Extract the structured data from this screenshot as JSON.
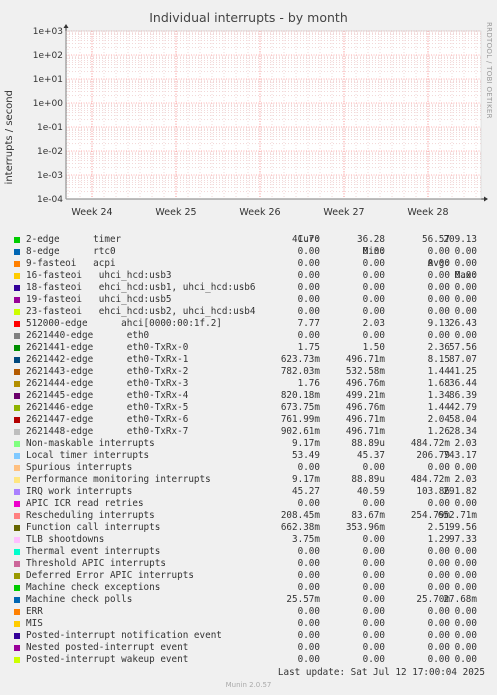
{
  "title": "Individual interrupts - by month",
  "side_note": "RRDTOOL / TOBI OETIKER",
  "footer": "Last update: Sat Jul 12 17:00:04 2025",
  "munin": "Munin 2.0.57",
  "colors": {
    "background": "#f0f0f0",
    "plot": "#ffffff",
    "grid_minor": "#e6b0b0",
    "grid_major": "#ff6666"
  },
  "legend_header": {
    "cur": "Cur:",
    "min": "Min:",
    "avg": "Avg:",
    "max": "Max:"
  },
  "chart_data": {
    "type": "line",
    "title": "Individual interrupts - by month",
    "ylabel": "interrupts / second",
    "yscale": "log",
    "ylim": [
      0.0001,
      1000
    ],
    "y_ticks": [
      "1e+03",
      "1e+02",
      "1e+01",
      "1e+00",
      "1e-01",
      "1e-02",
      "1e-03",
      "1e-04"
    ],
    "x_ticks": [
      "Week 24",
      "Week 25",
      "Week 26",
      "Week 27",
      "Week 28"
    ],
    "grid": true,
    "legend_position": "bottom",
    "series": [
      {
        "name": "2-edge      timer",
        "color": "#00cc00",
        "cur": "41.70",
        "min": "36.28",
        "avg": "56.57",
        "max": "209.13"
      },
      {
        "name": "8-edge      rtc0",
        "color": "#0066b3",
        "cur": "0.00",
        "min": "0.00",
        "avg": "0.00",
        "max": "0.00"
      },
      {
        "name": "9-fasteoi   acpi",
        "color": "#ff8000",
        "cur": "0.00",
        "min": "0.00",
        "avg": "0.00",
        "max": "0.00"
      },
      {
        "name": "16-fasteoi   uhci_hcd:usb3",
        "color": "#ffcc00",
        "cur": "0.00",
        "min": "0.00",
        "avg": "0.00",
        "max": "0.00"
      },
      {
        "name": "18-fasteoi   ehci_hcd:usb1, uhci_hcd:usb6",
        "color": "#330099",
        "cur": "0.00",
        "min": "0.00",
        "avg": "0.00",
        "max": "0.00"
      },
      {
        "name": "19-fasteoi   uhci_hcd:usb5",
        "color": "#990099",
        "cur": "0.00",
        "min": "0.00",
        "avg": "0.00",
        "max": "0.00"
      },
      {
        "name": "23-fasteoi   ehci_hcd:usb2, uhci_hcd:usb4",
        "color": "#ccff00",
        "cur": "0.00",
        "min": "0.00",
        "avg": "0.00",
        "max": "0.00"
      },
      {
        "name": "512000-edge      ahci[0000:00:1f.2]",
        "color": "#ff0000",
        "cur": "7.77",
        "min": "2.03",
        "avg": "9.13",
        "max": "26.43"
      },
      {
        "name": "2621440-edge      eth0",
        "color": "#808080",
        "cur": "0.00",
        "min": "0.00",
        "avg": "0.00",
        "max": "0.00"
      },
      {
        "name": "2621441-edge      eth0-TxRx-0",
        "color": "#008f00",
        "cur": "1.75",
        "min": "1.50",
        "avg": "2.36",
        "max": "57.56"
      },
      {
        "name": "2621442-edge      eth0-TxRx-1",
        "color": "#00487d",
        "cur": "623.73m",
        "min": "496.71m",
        "avg": "8.15",
        "max": "87.07"
      },
      {
        "name": "2621443-edge      eth0-TxRx-2",
        "color": "#b35a00",
        "cur": "782.03m",
        "min": "532.58m",
        "avg": "1.44",
        "max": "41.25"
      },
      {
        "name": "2621444-edge      eth0-TxRx-3",
        "color": "#b38f00",
        "cur": "1.76",
        "min": "496.76m",
        "avg": "1.68",
        "max": "36.44"
      },
      {
        "name": "2621445-edge      eth0-TxRx-4",
        "color": "#6b006b",
        "cur": "820.18m",
        "min": "499.21m",
        "avg": "1.34",
        "max": "86.39"
      },
      {
        "name": "2621446-edge      eth0-TxRx-5",
        "color": "#8fb300",
        "cur": "673.75m",
        "min": "496.76m",
        "avg": "1.44",
        "max": "42.79"
      },
      {
        "name": "2621447-edge      eth0-TxRx-6",
        "color": "#b30000",
        "cur": "761.99m",
        "min": "496.71m",
        "avg": "2.04",
        "max": "58.04"
      },
      {
        "name": "2621448-edge      eth0-TxRx-7",
        "color": "#bebebe",
        "cur": "902.61m",
        "min": "496.71m",
        "avg": "1.26",
        "max": "28.34"
      },
      {
        "name": "Non-maskable interrupts",
        "color": "#80ff80",
        "cur": "9.17m",
        "min": "88.89u",
        "avg": "484.72m",
        "max": "2.03"
      },
      {
        "name": "Local timer interrupts",
        "color": "#80c9ff",
        "cur": "53.49",
        "min": "45.37",
        "avg": "206.79",
        "max": "743.17"
      },
      {
        "name": "Spurious interrupts",
        "color": "#ffc080",
        "cur": "0.00",
        "min": "0.00",
        "avg": "0.00",
        "max": "0.00"
      },
      {
        "name": "Performance monitoring interrupts",
        "color": "#ffe680",
        "cur": "9.17m",
        "min": "88.89u",
        "avg": "484.72m",
        "max": "2.03"
      },
      {
        "name": "IRQ work interrupts",
        "color": "#aa80ff",
        "cur": "45.27",
        "min": "40.59",
        "avg": "103.86",
        "max": "291.82"
      },
      {
        "name": "APIC ICR read retries",
        "color": "#ee00cc",
        "cur": "0.00",
        "min": "0.00",
        "avg": "0.00",
        "max": "0.00"
      },
      {
        "name": "Rescheduling interrupts",
        "color": "#ff8080",
        "cur": "208.45m",
        "min": "83.67m",
        "avg": "254.79m",
        "max": "652.71m"
      },
      {
        "name": "Function call interrupts",
        "color": "#666600",
        "cur": "662.38m",
        "min": "353.96m",
        "avg": "2.51",
        "max": "99.56"
      },
      {
        "name": "TLB shootdowns",
        "color": "#ffbfff",
        "cur": "3.75m",
        "min": "0.00",
        "avg": "1.29",
        "max": "97.33"
      },
      {
        "name": "Thermal event interrupts",
        "color": "#00ffcc",
        "cur": "0.00",
        "min": "0.00",
        "avg": "0.00",
        "max": "0.00"
      },
      {
        "name": "Threshold APIC interrupts",
        "color": "#cc6699",
        "cur": "0.00",
        "min": "0.00",
        "avg": "0.00",
        "max": "0.00"
      },
      {
        "name": "Deferred Error APIC interrupts",
        "color": "#999900",
        "cur": "0.00",
        "min": "0.00",
        "avg": "0.00",
        "max": "0.00"
      },
      {
        "name": "Machine check exceptions",
        "color": "#00cc00",
        "cur": "0.00",
        "min": "0.00",
        "avg": "0.00",
        "max": "0.00"
      },
      {
        "name": "Machine check polls",
        "color": "#0066b3",
        "cur": "25.57m",
        "min": "0.00",
        "avg": "25.70m",
        "max": "27.68m"
      },
      {
        "name": "ERR",
        "color": "#ff8000",
        "cur": "0.00",
        "min": "0.00",
        "avg": "0.00",
        "max": "0.00"
      },
      {
        "name": "MIS",
        "color": "#ffcc00",
        "cur": "0.00",
        "min": "0.00",
        "avg": "0.00",
        "max": "0.00"
      },
      {
        "name": "Posted-interrupt notification event",
        "color": "#330099",
        "cur": "0.00",
        "min": "0.00",
        "avg": "0.00",
        "max": "0.00"
      },
      {
        "name": "Nested posted-interrupt event",
        "color": "#990099",
        "cur": "0.00",
        "min": "0.00",
        "avg": "0.00",
        "max": "0.00"
      },
      {
        "name": "Posted-interrupt wakeup event",
        "color": "#ccff00",
        "cur": "0.00",
        "min": "0.00",
        "avg": "0.00",
        "max": "0.00"
      }
    ]
  }
}
